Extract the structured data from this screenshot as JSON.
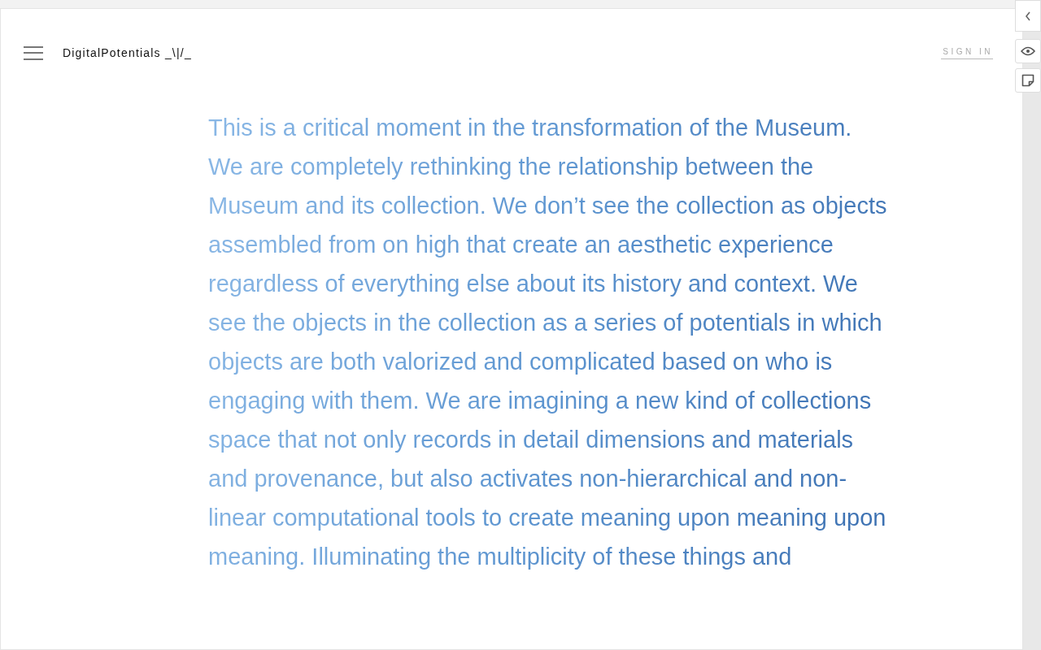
{
  "header": {
    "brand": "DigitalPotentials _\\|/_",
    "sign_in": "SIGN IN"
  },
  "article": {
    "paragraph": "This is a critical moment in the transformation of the Museum. We are completely rethinking the relationship between the Museum and its collection. We don’t see the collection as objects assembled from on high that create an aesthetic experience regardless of everything else about its history and context. We see the objects in the collection as a series of potentials in which objects are both valorized and complicated based on who is engaging with them. We are imagining a new kind of collections space that not only records in detail dimensions and materials and provenance, but also activates non-hierarchical and non-linear computational tools to create meaning upon meaning upon meaning. Illuminating the multiplicity of these things and"
  }
}
